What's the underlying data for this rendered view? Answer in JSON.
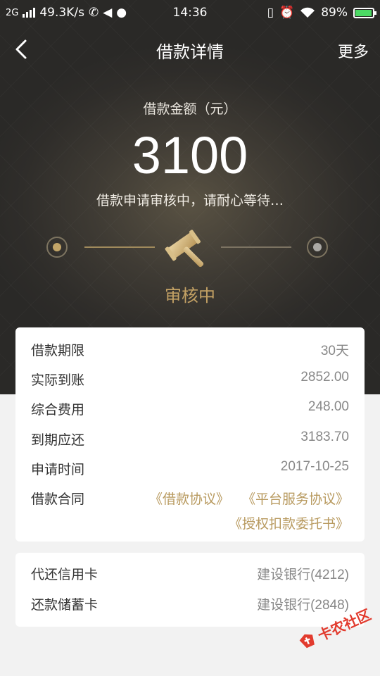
{
  "status_bar": {
    "network": "2G",
    "speed": "49.3K/s",
    "time": "14:36",
    "battery": "89%"
  },
  "nav": {
    "title": "借款详情",
    "more": "更多"
  },
  "loan": {
    "amount_label": "借款金额（元）",
    "amount": "3100",
    "status_text": "借款申请审核中，请耐心等待…",
    "stage_label": "审核中"
  },
  "details": [
    {
      "label": "借款期限",
      "value": "30天"
    },
    {
      "label": "实际到账",
      "value": "2852.00"
    },
    {
      "label": "综合费用",
      "value": "248.00"
    },
    {
      "label": "到期应还",
      "value": "3183.70"
    },
    {
      "label": "申请时间",
      "value": "2017-10-25"
    }
  ],
  "contract": {
    "label": "借款合同",
    "links": [
      "《借款协议》",
      "《平台服务协议》",
      "《授权扣款委托书》"
    ]
  },
  "cards": [
    {
      "label": "代还信用卡",
      "value": "建设银行(4212)"
    },
    {
      "label": "还款储蓄卡",
      "value": "建设银行(2848)"
    }
  ],
  "watermark": "卡农社区",
  "colors": {
    "accent_gold": "#c3a164",
    "link_gold": "#b89a5f",
    "header_dark": "#2f2d2a"
  }
}
